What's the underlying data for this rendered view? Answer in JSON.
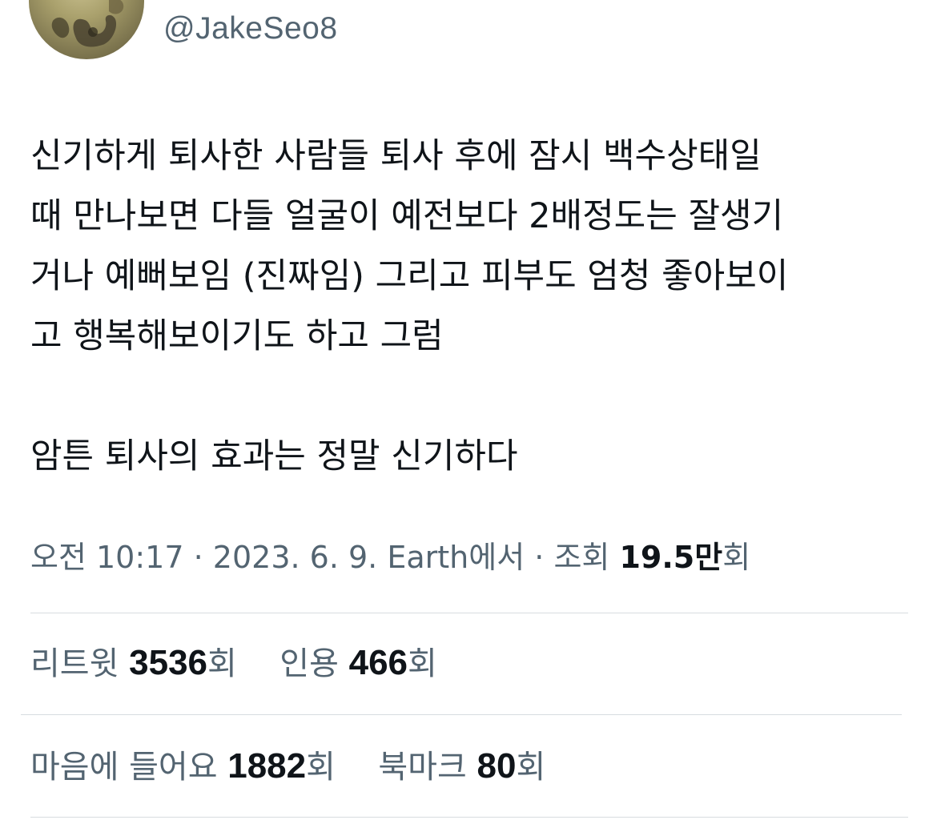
{
  "author": {
    "handle": "@JakeSeo8"
  },
  "tweet": {
    "text": "신기하게 퇴사한 사람들 퇴사 후에 잠시 백수상태일\n때 만나보면 다들 얼굴이 예전보다 2배정도는 잘생기\n거나 예뻐보임 (진짜임) 그리고 피부도 엄청 좋아보이\n고 행복해보이기도 하고 그럼\n\n암튼 퇴사의 효과는 정말 신기하다"
  },
  "meta": {
    "time": "오전 10:17",
    "separator": "·",
    "date": "2023. 6. 9.",
    "source": "Earth에서",
    "views_label": "조회",
    "views_value": "19.5만",
    "views_suffix": "회"
  },
  "stats": {
    "retweets_label": "리트윗",
    "retweets_value": "3536",
    "quotes_label": "인용",
    "quotes_value": "466",
    "likes_label": "마음에 들어요",
    "likes_value": "1882",
    "bookmarks_label": "북마크",
    "bookmarks_value": "80",
    "count_suffix": "회"
  },
  "colors": {
    "text_primary": "#0f1419",
    "text_secondary": "#536471",
    "divider": "#d7dce0"
  }
}
